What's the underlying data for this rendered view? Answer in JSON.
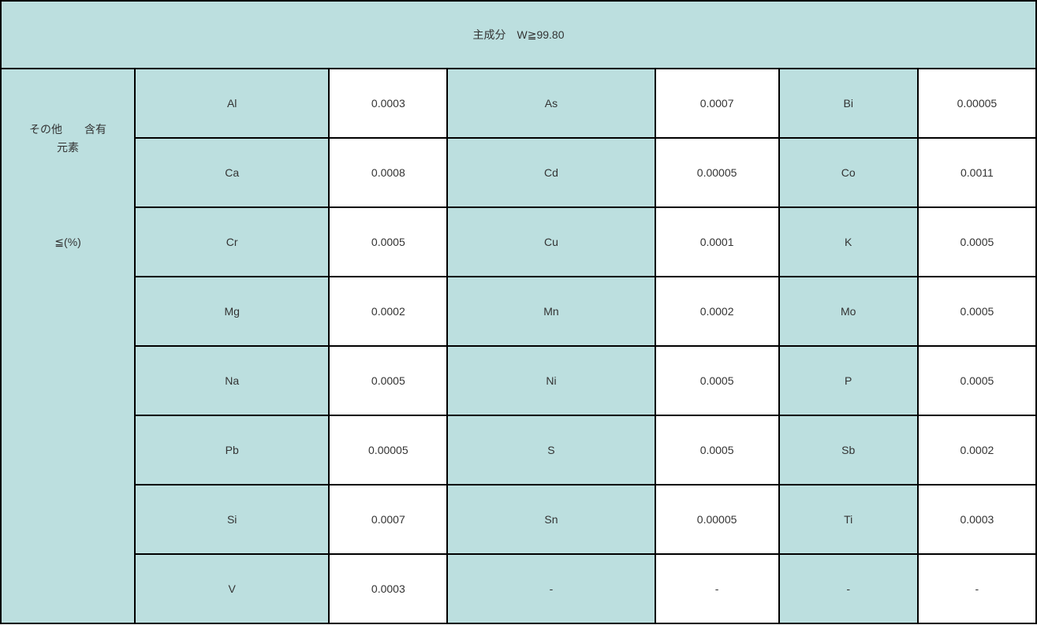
{
  "header": "主成分　W≧99.80",
  "sidebar": {
    "line1": "その他　　含有",
    "line2": "元素",
    "line3": "≦(%)"
  },
  "rows": [
    {
      "e1": "Al",
      "v1": "0.0003",
      "e2": "As",
      "v2": "0.0007",
      "e3": "Bi",
      "v3": "0.00005"
    },
    {
      "e1": "Ca",
      "v1": "0.0008",
      "e2": "Cd",
      "v2": "0.00005",
      "e3": "Co",
      "v3": "0.0011"
    },
    {
      "e1": "Cr",
      "v1": "0.0005",
      "e2": "Cu",
      "v2": "0.0001",
      "e3": "K",
      "v3": "0.0005"
    },
    {
      "e1": "Mg",
      "v1": "0.0002",
      "e2": "Mn",
      "v2": "0.0002",
      "e3": "Mo",
      "v3": "0.0005"
    },
    {
      "e1": "Na",
      "v1": "0.0005",
      "e2": "Ni",
      "v2": "0.0005",
      "e3": "P",
      "v3": "0.0005"
    },
    {
      "e1": "Pb",
      "v1": "0.00005",
      "e2": "S",
      "v2": "0.0005",
      "e3": "Sb",
      "v3": "0.0002"
    },
    {
      "e1": "Si",
      "v1": "0.0007",
      "e2": "Sn",
      "v2": "0.00005",
      "e3": "Ti",
      "v3": "0.0003"
    },
    {
      "e1": "V",
      "v1": "0.0003",
      "e2": "-",
      "v2": "-",
      "e3": "-",
      "v3": "-"
    }
  ]
}
